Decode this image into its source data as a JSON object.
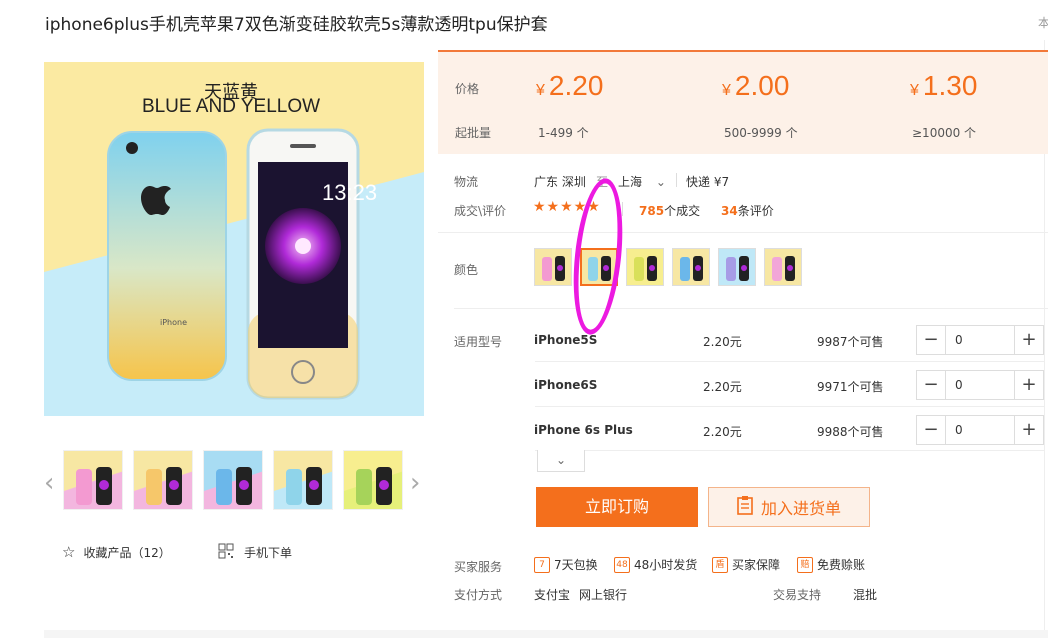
{
  "product_title": "iphone6plus手机壳苹果7双色渐变硅胶软壳5s薄款透明tpu保护套",
  "corner_text": "本",
  "main_image": {
    "title_zh": "天蓝黄",
    "title_en": "BLUE AND YELLOW",
    "screen_time": "13:23",
    "back_text": "iPhone"
  },
  "favorite": {
    "icon": "star-outline-icon",
    "label": "收藏产品（12）"
  },
  "mobile_order": {
    "icon": "qr-code-icon",
    "label": "手机下单"
  },
  "pricing": {
    "price_label": "价格",
    "min_qty_label": "起批量",
    "currency": "¥",
    "tiers": [
      {
        "price": "2.20",
        "qty": "1-499 个"
      },
      {
        "price": "2.00",
        "qty": "500-9999 个"
      },
      {
        "price": "1.30",
        "qty": "≥10000 个"
      }
    ]
  },
  "logistics": {
    "label": "物流",
    "from": "广东 深圳",
    "to_word": "至",
    "to": "上海",
    "shipping": "快递 ¥7"
  },
  "reviews": {
    "label": "成交\\评价",
    "stars": "★★★★★",
    "deals_count": "785",
    "deals_text": "个成交",
    "review_count": "34",
    "review_text": "条评价"
  },
  "color": {
    "label": "颜色"
  },
  "models": {
    "label": "适用型号",
    "rows": [
      {
        "model": "iPhone5S",
        "price": "2.20元",
        "stock": "9987个可售",
        "qty": "0"
      },
      {
        "model": "iPhone6S",
        "price": "2.20元",
        "stock": "9971个可售",
        "qty": "0"
      },
      {
        "model": "iPhone 6s Plus",
        "price": "2.20元",
        "stock": "9988个可售",
        "qty": "0"
      }
    ]
  },
  "actions": {
    "buy_now": "立即订购",
    "add_to_list": "加入进货单"
  },
  "services": {
    "label": "买家服务",
    "items": [
      {
        "icon": "7",
        "text": "7天包换"
      },
      {
        "icon": "48",
        "text": "48小时发货"
      },
      {
        "icon": "盾",
        "text": "买家保障"
      },
      {
        "icon": "赔",
        "text": "免费赊账"
      }
    ]
  },
  "payment": {
    "label": "支付方式",
    "methods": [
      "支付宝",
      "网上银行"
    ],
    "trade_label": "交易支持",
    "trade_value": "混批"
  },
  "colors": {
    "accent": "#f46f1c",
    "annotation": "#ec1ae0"
  }
}
